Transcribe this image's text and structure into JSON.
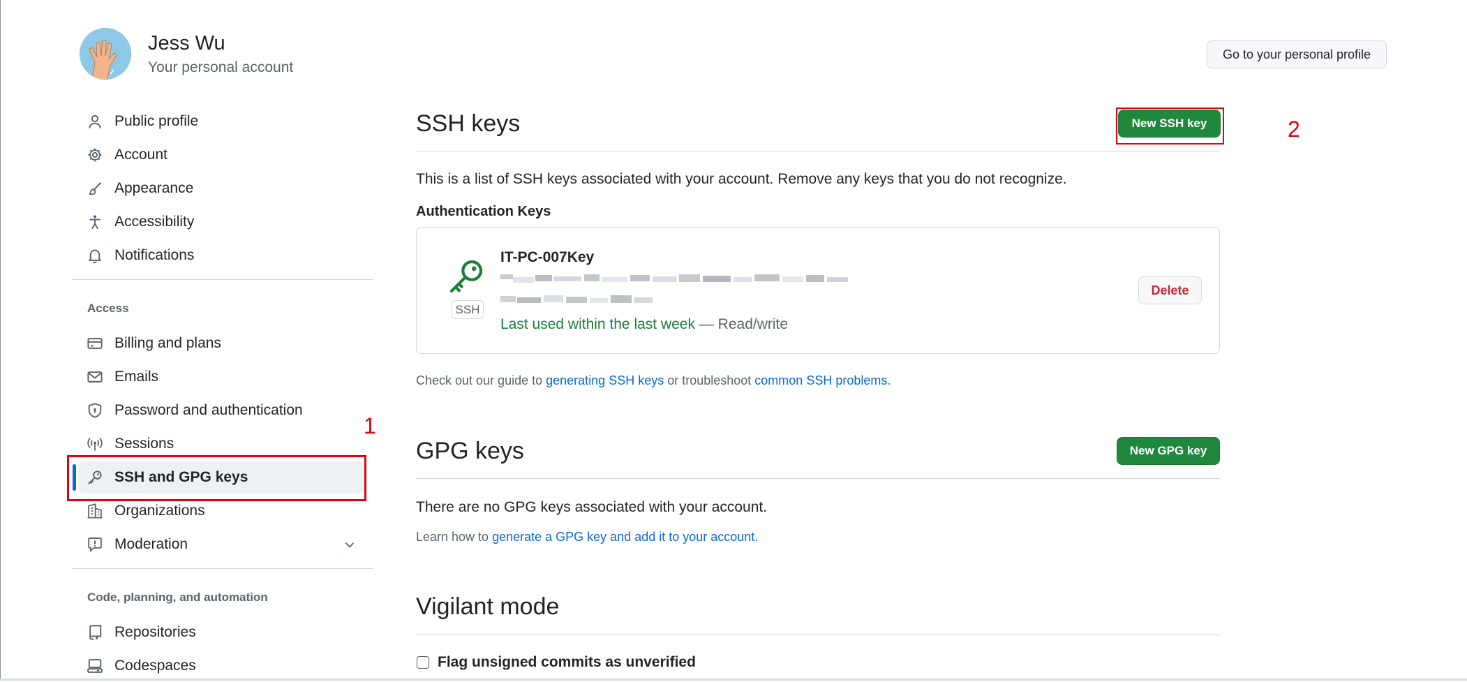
{
  "header": {
    "user_name": "Jess Wu",
    "user_subtitle": "Your personal account",
    "profile_button": "Go to your personal profile"
  },
  "sidebar": {
    "items": [
      {
        "label": "Public profile",
        "icon": "person-icon"
      },
      {
        "label": "Account",
        "icon": "gear-icon"
      },
      {
        "label": "Appearance",
        "icon": "paintbrush-icon"
      },
      {
        "label": "Accessibility",
        "icon": "accessibility-icon"
      },
      {
        "label": "Notifications",
        "icon": "bell-icon"
      }
    ],
    "access_label": "Access",
    "access_items": [
      {
        "label": "Billing and plans",
        "icon": "credit-card-icon"
      },
      {
        "label": "Emails",
        "icon": "mail-icon"
      },
      {
        "label": "Password and authentication",
        "icon": "shield-lock-icon"
      },
      {
        "label": "Sessions",
        "icon": "broadcast-icon"
      },
      {
        "label": "SSH and GPG keys",
        "icon": "key-icon",
        "active": true
      },
      {
        "label": "Organizations",
        "icon": "organization-icon"
      },
      {
        "label": "Moderation",
        "icon": "report-icon",
        "expandable": true
      }
    ],
    "code_label": "Code, planning, and automation",
    "code_items": [
      {
        "label": "Repositories",
        "icon": "repo-icon"
      },
      {
        "label": "Codespaces",
        "icon": "codespaces-icon"
      }
    ]
  },
  "ssh": {
    "title": "SSH keys",
    "new_button": "New SSH key",
    "description": "This is a list of SSH keys associated with your account. Remove any keys that you do not recognize.",
    "auth_heading": "Authentication Keys",
    "key": {
      "name": "IT-PC-007Key",
      "badge": "SSH",
      "last_used": "Last used within the last week",
      "access": "— Read/write",
      "delete_button": "Delete"
    },
    "guide": {
      "prefix": "Check out our guide to ",
      "link1": "generating SSH keys",
      "middle": " or troubleshoot ",
      "link2": "common SSH problems",
      "suffix": "."
    }
  },
  "gpg": {
    "title": "GPG keys",
    "new_button": "New GPG key",
    "empty_text": "There are no GPG keys associated with your account.",
    "learn": {
      "prefix": "Learn how to ",
      "link": "generate a GPG key and add it to your account",
      "suffix": "."
    }
  },
  "vigilant": {
    "title": "Vigilant mode",
    "checkbox_label": "Flag unsigned commits as unverified"
  },
  "annotations": {
    "first": "1",
    "second": "2"
  },
  "colors": {
    "accent": "#0969da",
    "primary_button": "#1f883d",
    "danger": "#d1242f",
    "annotation": "#e3000f"
  }
}
